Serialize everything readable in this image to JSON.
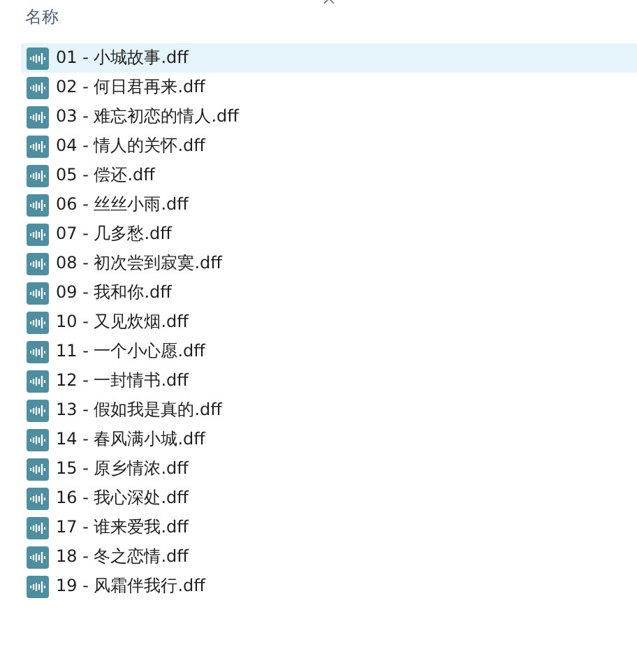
{
  "header": {
    "label": "名称"
  },
  "files": [
    {
      "name": "01 - 小城故事.dff",
      "selected": true
    },
    {
      "name": "02 - 何日君再来.dff",
      "selected": false
    },
    {
      "name": "03 - 难忘初恋的情人.dff",
      "selected": false
    },
    {
      "name": "04 - 情人的关怀.dff",
      "selected": false
    },
    {
      "name": "05 - 偿还.dff",
      "selected": false
    },
    {
      "name": "06 - 丝丝小雨.dff",
      "selected": false
    },
    {
      "name": "07 - 几多愁.dff",
      "selected": false
    },
    {
      "name": "08 - 初次尝到寂寞.dff",
      "selected": false
    },
    {
      "name": "09 - 我和你.dff",
      "selected": false
    },
    {
      "name": "10 - 又见炊烟.dff",
      "selected": false
    },
    {
      "name": "11 - 一个小心愿.dff",
      "selected": false
    },
    {
      "name": "12 - 一封情书.dff",
      "selected": false
    },
    {
      "name": "13 - 假如我是真的.dff",
      "selected": false
    },
    {
      "name": "14 - 春风满小城.dff",
      "selected": false
    },
    {
      "name": "15 - 原乡情浓.dff",
      "selected": false
    },
    {
      "name": "16 - 我心深处.dff",
      "selected": false
    },
    {
      "name": "17 - 谁来爱我.dff",
      "selected": false
    },
    {
      "name": "18 - 冬之恋情.dff",
      "selected": false
    },
    {
      "name": "19 - 风霜伴我行.dff",
      "selected": false
    }
  ]
}
